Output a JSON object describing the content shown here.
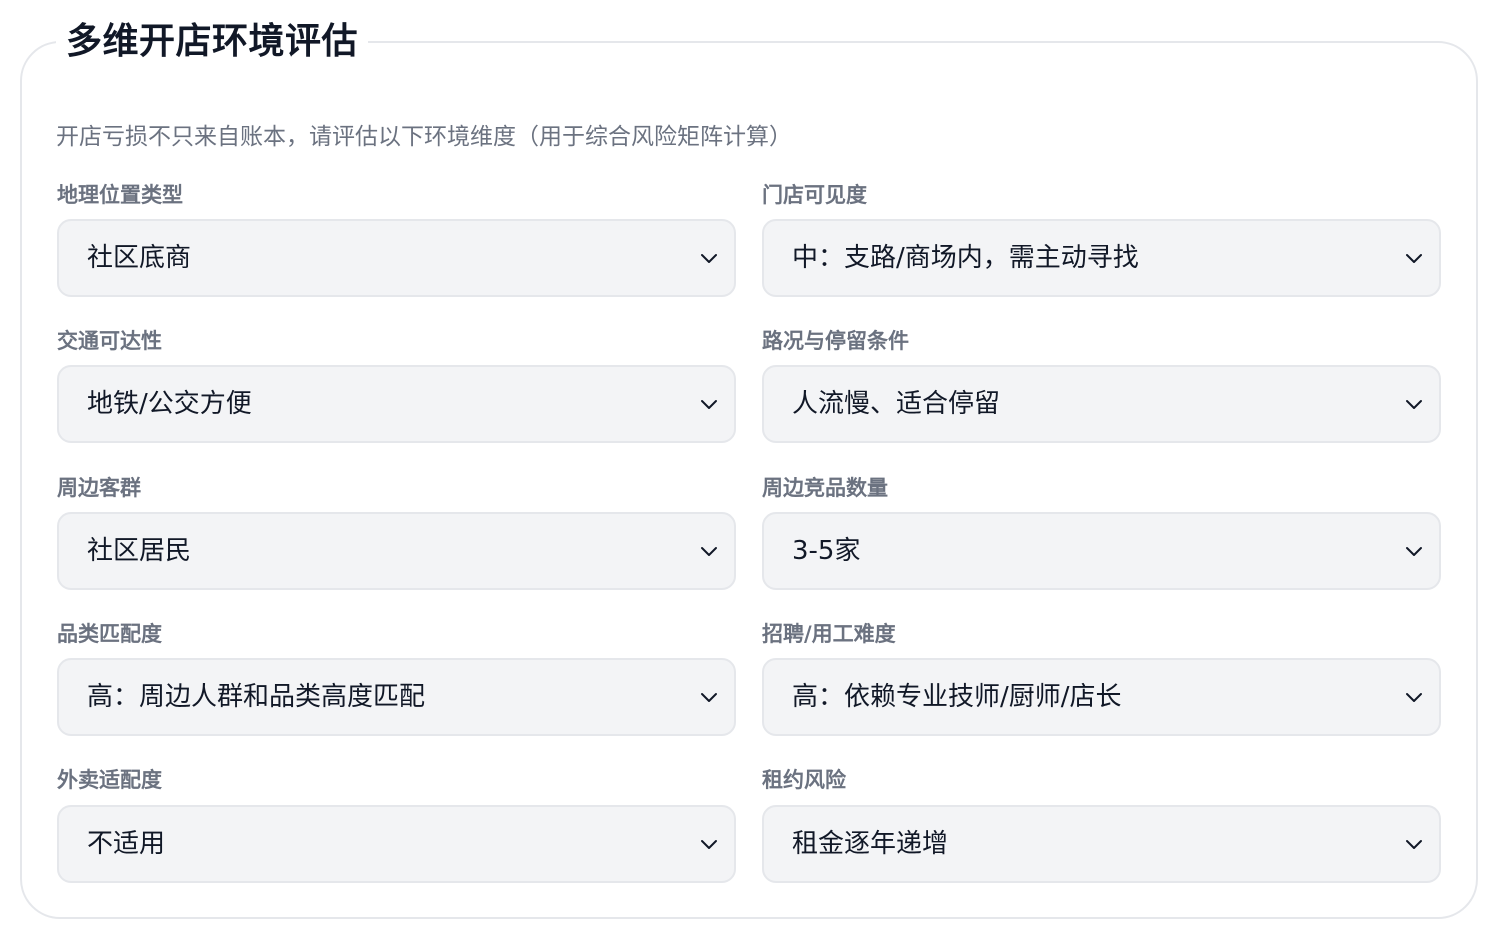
{
  "title": "多维开店环境评估",
  "description": "开店亏损不只来自账本，请评估以下环境维度（用于综合风险矩阵计算）",
  "fields": [
    {
      "label": "地理位置类型",
      "value": "社区底商"
    },
    {
      "label": "门店可见度",
      "value": "中：支路/商场内，需主动寻找"
    },
    {
      "label": "交通可达性",
      "value": "地铁/公交方便"
    },
    {
      "label": "路况与停留条件",
      "value": "人流慢、适合停留"
    },
    {
      "label": "周边客群",
      "value": "社区居民"
    },
    {
      "label": "周边竞品数量",
      "value": "3-5家"
    },
    {
      "label": "品类匹配度",
      "value": "高：周边人群和品类高度匹配"
    },
    {
      "label": "招聘/用工难度",
      "value": "高：依赖专业技师/厨师/店长"
    },
    {
      "label": "外卖适配度",
      "value": "不适用"
    },
    {
      "label": "租约风险",
      "value": "租金逐年递增"
    }
  ],
  "icons": {
    "dropdown": "chevron-down-icon"
  },
  "colors": {
    "border": "#e5e7eb",
    "select_bg": "#f3f4f6",
    "label": "#6b7280",
    "text": "#111827"
  }
}
